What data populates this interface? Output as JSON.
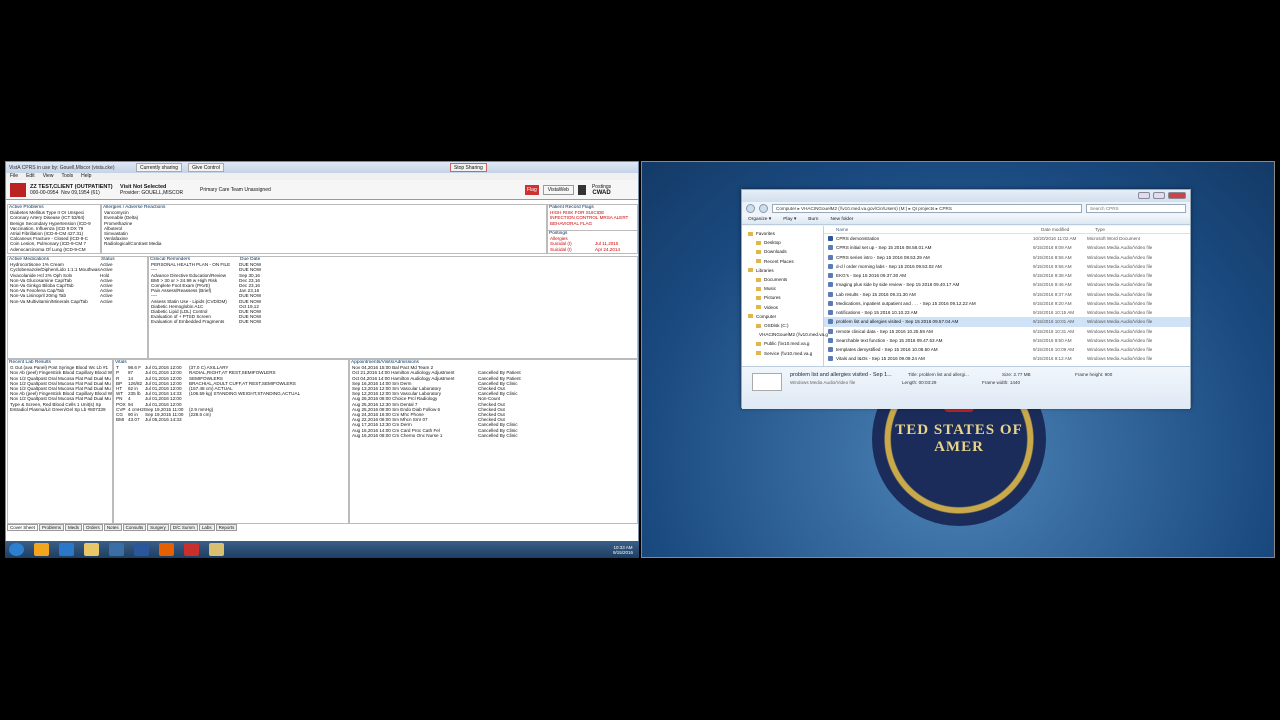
{
  "cprs": {
    "window_title": "VistA CPRS in use by: Gouell,Mlscor  (vista.cke)",
    "sharing_status": "Currently sharing",
    "give_control": "Give Control",
    "stop_sharing": "Stop Sharing",
    "menu": [
      "File",
      "Edit",
      "View",
      "Tools",
      "Help"
    ],
    "patient": {
      "name": "ZZ TEST,CLIENT (OUTPATIENT)",
      "id": "000-00-0954",
      "dob": "Nov 09,1954 (61)",
      "visit": "Visit Not Selected",
      "provider": "Provider: GOUELL,MISCOR",
      "team": "Primary Care Team Unassigned",
      "flag": "Flag",
      "vistaweb": "VistaWeb",
      "postings": "Postings",
      "postings_code": "CWAD"
    },
    "active_problems": {
      "header": "Active Problems",
      "items": [
        "Diabetes Mellitus Type II Or Unspeci",
        "Coronary Artery Disease (ICT 53/64)",
        "Benign Secondary Hypertension (ICD-9",
        "Vaccination, Influenza (ICD 9 DX 79",
        "Atrial Fibrillation (ICD-9-CM 427.31)",
        "Calcaneus Fracture - Closed (ICD-9-C",
        "Coin Lesion, Pulmonary (ICD-9-CM 7",
        "Adenocarcinoma Of Lung (ICD-9-CM"
      ]
    },
    "allergies": {
      "header": "Allergies / Adverse Reactions",
      "items": [
        "Vancomycin",
        "Evenable (Delta)",
        "Promethazine",
        "Albuterol",
        "Simvastatin",
        "Venlafaxine",
        "Radiological/Contrast Media"
      ]
    },
    "record_flags": {
      "header": "Patient Record Flags",
      "items": [
        "HIGH RISK FOR SUICIDE",
        "INFECTION CONTROL MRSA ALERT",
        "BEHAVIORAL FLAG"
      ]
    },
    "postings_pane": {
      "header": "Postings",
      "items": [
        {
          "label": "Allergies",
          "date": ""
        },
        {
          "label": "Suicidal (I)",
          "date": "Jul 11,2015"
        },
        {
          "label": "Suicidal (I)",
          "date": "Apr 24,2014"
        }
      ]
    },
    "medications": {
      "header": "Active Medications",
      "status_header": "Status",
      "items": [
        {
          "name": "Hydrocortisone 1% Cream",
          "status": "Active"
        },
        {
          "name": "Cyclobenazole/Diphen/Lido 1:1:1 Mouthwash",
          "status": "Active"
        },
        {
          "name": "Vivacolanide Hcl 2% Oph Soln",
          "status": "Hold"
        },
        {
          "name": "Non-Va Glucosamine Cap/Tab",
          "status": "Active"
        },
        {
          "name": "Non-Va Ginkgo Biloba Cap/Tab",
          "status": "Active"
        },
        {
          "name": "Non-Va Fexofena Cap/Tab",
          "status": "Active"
        },
        {
          "name": "Non-Va Lisinopril 20mg Tab",
          "status": "Active"
        },
        {
          "name": "Non-Va Multivitamin/Minerals Cap/Tab",
          "status": "Active"
        }
      ]
    },
    "reminders": {
      "header": "Clinical Reminders",
      "due_header": "Due Date",
      "items": [
        {
          "name": "PERSONAL HEALTH PLAN - ON FILE",
          "due": "DUE NOW"
        },
        {
          "name": "----",
          "due": "DUE NOW"
        },
        {
          "name": "Advance Directive Education/Review",
          "due": "Sep 30,16"
        },
        {
          "name": "BMI > 30 or > 24.99 w High Risk",
          "due": "Dec 23,16"
        },
        {
          "name": "Complete Foot Exam (PAVE)",
          "due": "Dec 23,16"
        },
        {
          "name": "Pain Assess/Reassess (Brief)",
          "due": "Jan 23,16"
        },
        {
          "name": "----",
          "due": "DUE NOW"
        },
        {
          "name": "Assess Statin Use - Lipids (CVD/DM)",
          "due": "DUE NOW"
        },
        {
          "name": "Diabetic Hemoglobin A1C",
          "due": "Oct 19,12"
        },
        {
          "name": "Diabetic Lipid (LDL) Control",
          "due": "DUE NOW"
        },
        {
          "name": "Evaluation of + PTSD Screen",
          "due": "DUE NOW"
        },
        {
          "name": "Evaluation of Embedded Fragments",
          "due": "DUE NOW"
        }
      ]
    },
    "labs": {
      "header": "Recent Lab Results",
      "items": [
        "G Gut (ava Panel) Post Syringe Blood Wc Lb #1",
        "Nov Ab (peel) Fingerstick Blood Capillary Blood W",
        "Nov 1/2 Qualtpost Oral Mucosa Flat Pad Dual Mu",
        "Nov 1/2 Qualtpost Oral Mucosa Flat Pad Dual Mu",
        "Nov 1/2 Qualtpost Oral Mucosa Flat Pad Dual Mu",
        "Nov Ab (peel) Fingerstick Blood Capillary Blood W",
        "Nov 1/2 Qualtpost Oral Mucosa Flat Pad Dual Mu",
        "Type & Screen, Red Blood Cells 1 Unit(s) Sp",
        "Estradiol Plasma/Lit Green/Gel Sp Lb #807339"
      ]
    },
    "vitals": {
      "header": "Vitals",
      "items": [
        {
          "code": "T",
          "value": "98.6 F",
          "date": "Jul 01,2016 12:00",
          "extra": "(37.0 C)   AXILLARY"
        },
        {
          "code": "P",
          "value": "87",
          "date": "Jul 01,2016 12:00",
          "extra": "RADIAL,RIGHT,AT REST,SEMIFOWLERS"
        },
        {
          "code": "R",
          "value": "14",
          "date": "Jul 01,2016 12:00",
          "extra": "SEMIFOWLERS"
        },
        {
          "code": "BP",
          "value": "126/82",
          "date": "Jul 01,2016 12:00",
          "extra": "BRACHIAL,ADULT CUFF,AT REST,SEMIFOWLERS"
        },
        {
          "code": "HT",
          "value": "62 in",
          "date": "Jul 01,2016 12:00",
          "extra": "(157.48 cm)   ACTUAL"
        },
        {
          "code": "WT",
          "value": "235 lb",
          "date": "Jul 01,2016 14:33",
          "extra": "(106.59 kg)   STANDING WEIGHT,STANDING,ACTUAL"
        },
        {
          "code": "PN",
          "value": "4",
          "date": "Jul 01,2016 12:00",
          "extra": ""
        },
        {
          "code": "POX",
          "value": "94",
          "date": "Jul 01,2016 12:00",
          "extra": ""
        },
        {
          "code": "CVP",
          "value": "4 cmH20",
          "date": "Sep 19,2015 11:00",
          "extra": "(2.9 mmHg)"
        },
        {
          "code": "CG",
          "value": "90 in",
          "date": "Sep 19,2015 11:00",
          "extra": "(228.6 cm)"
        },
        {
          "code": "BMI",
          "value": "43.07",
          "date": "Jul 05,2016 14:33",
          "extra": ""
        }
      ]
    },
    "appointments": {
      "header": "Appointments/Visits/Admissions",
      "items": [
        {
          "when": "Nov 04,2016 15:00 Bal Pact Md Team 2",
          "status": ""
        },
        {
          "when": "Oct 21,2016 14:00  Hamilton Audiology Adjustment",
          "status": "Cancelled By Patient"
        },
        {
          "when": "Oct 04,2016 14:00  Hamilton Audiology Adjustment",
          "status": "Cancelled By Patient"
        },
        {
          "when": "Sep 16,2016 14:00 Sm Derm",
          "status": "Cancelled By Clinic"
        },
        {
          "when": "Sep 13,2016 12:00 Sm Vascular Laboratory",
          "status": "Checked Out"
        },
        {
          "when": "Sep 12,2016 12:00 Sm Vascular Laboratory",
          "status": "Cancelled By Clinic"
        },
        {
          "when": "Aug 26,2016 08:00 Choice Prcl Radiology",
          "status": "Non-Count"
        },
        {
          "when": "Aug 25,2016 12:30 Sm Dental 7",
          "status": "Checked Out"
        },
        {
          "when": "Aug 25,2016 08:00 Sm Endo Diab Follow 6",
          "status": "Checked Out"
        },
        {
          "when": "Aug 24,2016 16:00 Cm Mhc Phone",
          "status": "Checked Out"
        },
        {
          "when": "Aug 22,2016 08:00 Sm Mhcn Smr 07",
          "status": "Checked Out"
        },
        {
          "when": "Aug 17,2016 13:30 Cm Derm",
          "status": "Cancelled By Clinic"
        },
        {
          "when": "Aug 16,2016 14:00 Cm Card Proc Cath Fel",
          "status": "Cancelled By Clinic"
        },
        {
          "when": "Aug 16,2016 08:00 Cm Chemo Onc Nurse 1",
          "status": "Cancelled By Clinic"
        }
      ]
    },
    "tabs": [
      "Cover Sheet",
      "Problems",
      "Meds",
      "Orders",
      "Notes",
      "Consults",
      "Surgery",
      "D/C Summ",
      "Labs",
      "Reports"
    ]
  },
  "taskbar": {
    "clock_time": "10:33 AM",
    "clock_date": "9/15/2016",
    "icons": [
      "start-orb-icon",
      "media-player-icon",
      "ie-icon",
      "folder-icon",
      "cprs-icon",
      "word-icon",
      "firefox-icon",
      "vista-icon",
      "notepad-icon"
    ]
  },
  "desktop": {
    "seal_text": "TED STATES OF AMER"
  },
  "explorer": {
    "address": "Computer  ▸  VHACINGouelM2 (\\\\v10.med.va.gov\\Cin\\Users) (M:)  ▸  QI projects  ▸  CPRS",
    "search_placeholder": "Search CPRS",
    "toolbar": [
      "Organize ▾",
      "Play ▾",
      "Burn",
      "New folder"
    ],
    "nav": [
      {
        "label": "Favorites",
        "sub": false
      },
      {
        "label": "Desktop",
        "sub": true
      },
      {
        "label": "Downloads",
        "sub": true
      },
      {
        "label": "Recent Places",
        "sub": true
      },
      {
        "label": "",
        "sub": false
      },
      {
        "label": "Libraries",
        "sub": false
      },
      {
        "label": "Documents",
        "sub": true
      },
      {
        "label": "Music",
        "sub": true
      },
      {
        "label": "Pictures",
        "sub": true
      },
      {
        "label": "Videos",
        "sub": true
      },
      {
        "label": "",
        "sub": false
      },
      {
        "label": "Computer",
        "sub": false
      },
      {
        "label": "OSDisk (C:)",
        "sub": true
      },
      {
        "label": "VHACINGouelM2 (\\\\v10.med.va.g",
        "sub": true
      },
      {
        "label": "Public (\\\\v10.med.va.g",
        "sub": true
      },
      {
        "label": "Service (\\\\v10.med.va.g",
        "sub": true
      }
    ],
    "columns": [
      "Name",
      "Date modified",
      "Type"
    ],
    "files": [
      {
        "name": "CPRS demonstration",
        "date": "10/20/2016 11:02 AM",
        "type": "Microsoft Word Document"
      },
      {
        "name": "CPRS initial set up - Sep 15 2016 08.58.01 AM",
        "date": "9/15/2016 9:09 AM",
        "type": "Windows Media Audio/Video file"
      },
      {
        "name": "CPRS series intro - Sep 15 2016 08.53.29 AM",
        "date": "9/15/2016 8:56 AM",
        "type": "Windows Media Audio/Video file"
      },
      {
        "name": "d-d l order morning labs - Sep 15 2016 09.53.02 AM",
        "date": "9/15/2016 9:56 AM",
        "type": "Windows Media Audio/Video file"
      },
      {
        "name": "EKG's - Sep 15 2016 09.37.30 AM",
        "date": "9/15/2016 9:38 AM",
        "type": "Windows Media Audio/Video file"
      },
      {
        "name": "Imaging plus side by side review - Sep 15 2016 09.40.17 AM",
        "date": "9/15/2016 9:46 AM",
        "type": "Windows Media Audio/Video file"
      },
      {
        "name": "Lab results - Sep 15 2016 09.31.30 AM",
        "date": "9/15/2016 9:37 AM",
        "type": "Windows Media Audio/Video file"
      },
      {
        "name": "Medications, inpatient outpatient and . . . - Sep 15 2016 09.12.22 AM",
        "date": "9/15/2016 9:20 AM",
        "type": "Windows Media Audio/Video file"
      },
      {
        "name": "notifications - Sep 15 2016 10.10.23 AM",
        "date": "9/15/2016 10:15 AM",
        "type": "Windows Media Audio/Video file"
      },
      {
        "name": "problem list and allergies visited - Sep 15 2016 09.57.04 AM",
        "date": "9/15/2016 10:01 AM",
        "type": "Windows Media Audio/Video file"
      },
      {
        "name": "remote clinical data - Sep 15 2016 10.25.59 AM",
        "date": "9/15/2016 10:31 AM",
        "type": "Windows Media Audio/Video file"
      },
      {
        "name": "Searchable text function - Sep 15 2016 09.47.53 AM",
        "date": "9/15/2016 9:50 AM",
        "type": "Windows Media Audio/Video file"
      },
      {
        "name": "templates demystified - Sep 15 2016 10.06.50 AM",
        "date": "9/15/2016 10:09 AM",
        "type": "Windows Media Audio/Video file"
      },
      {
        "name": "Vitals and I&Os - Sep 15 2016 09.09.24 AM",
        "date": "9/15/2016 9:12 AM",
        "type": "Windows Media Audio/Video file"
      }
    ],
    "selected_index": 9,
    "details": {
      "name": "problem list and allergies visited - Sep 1...",
      "type": "Windows Media Audio/Video file",
      "title": "Title:  problem list and allergi...",
      "length": "Length:  00:03:29",
      "size": "Size:  2.77 MB",
      "frame_width": "Frame width:  1440",
      "frame_height": "Frame height:  900"
    }
  }
}
